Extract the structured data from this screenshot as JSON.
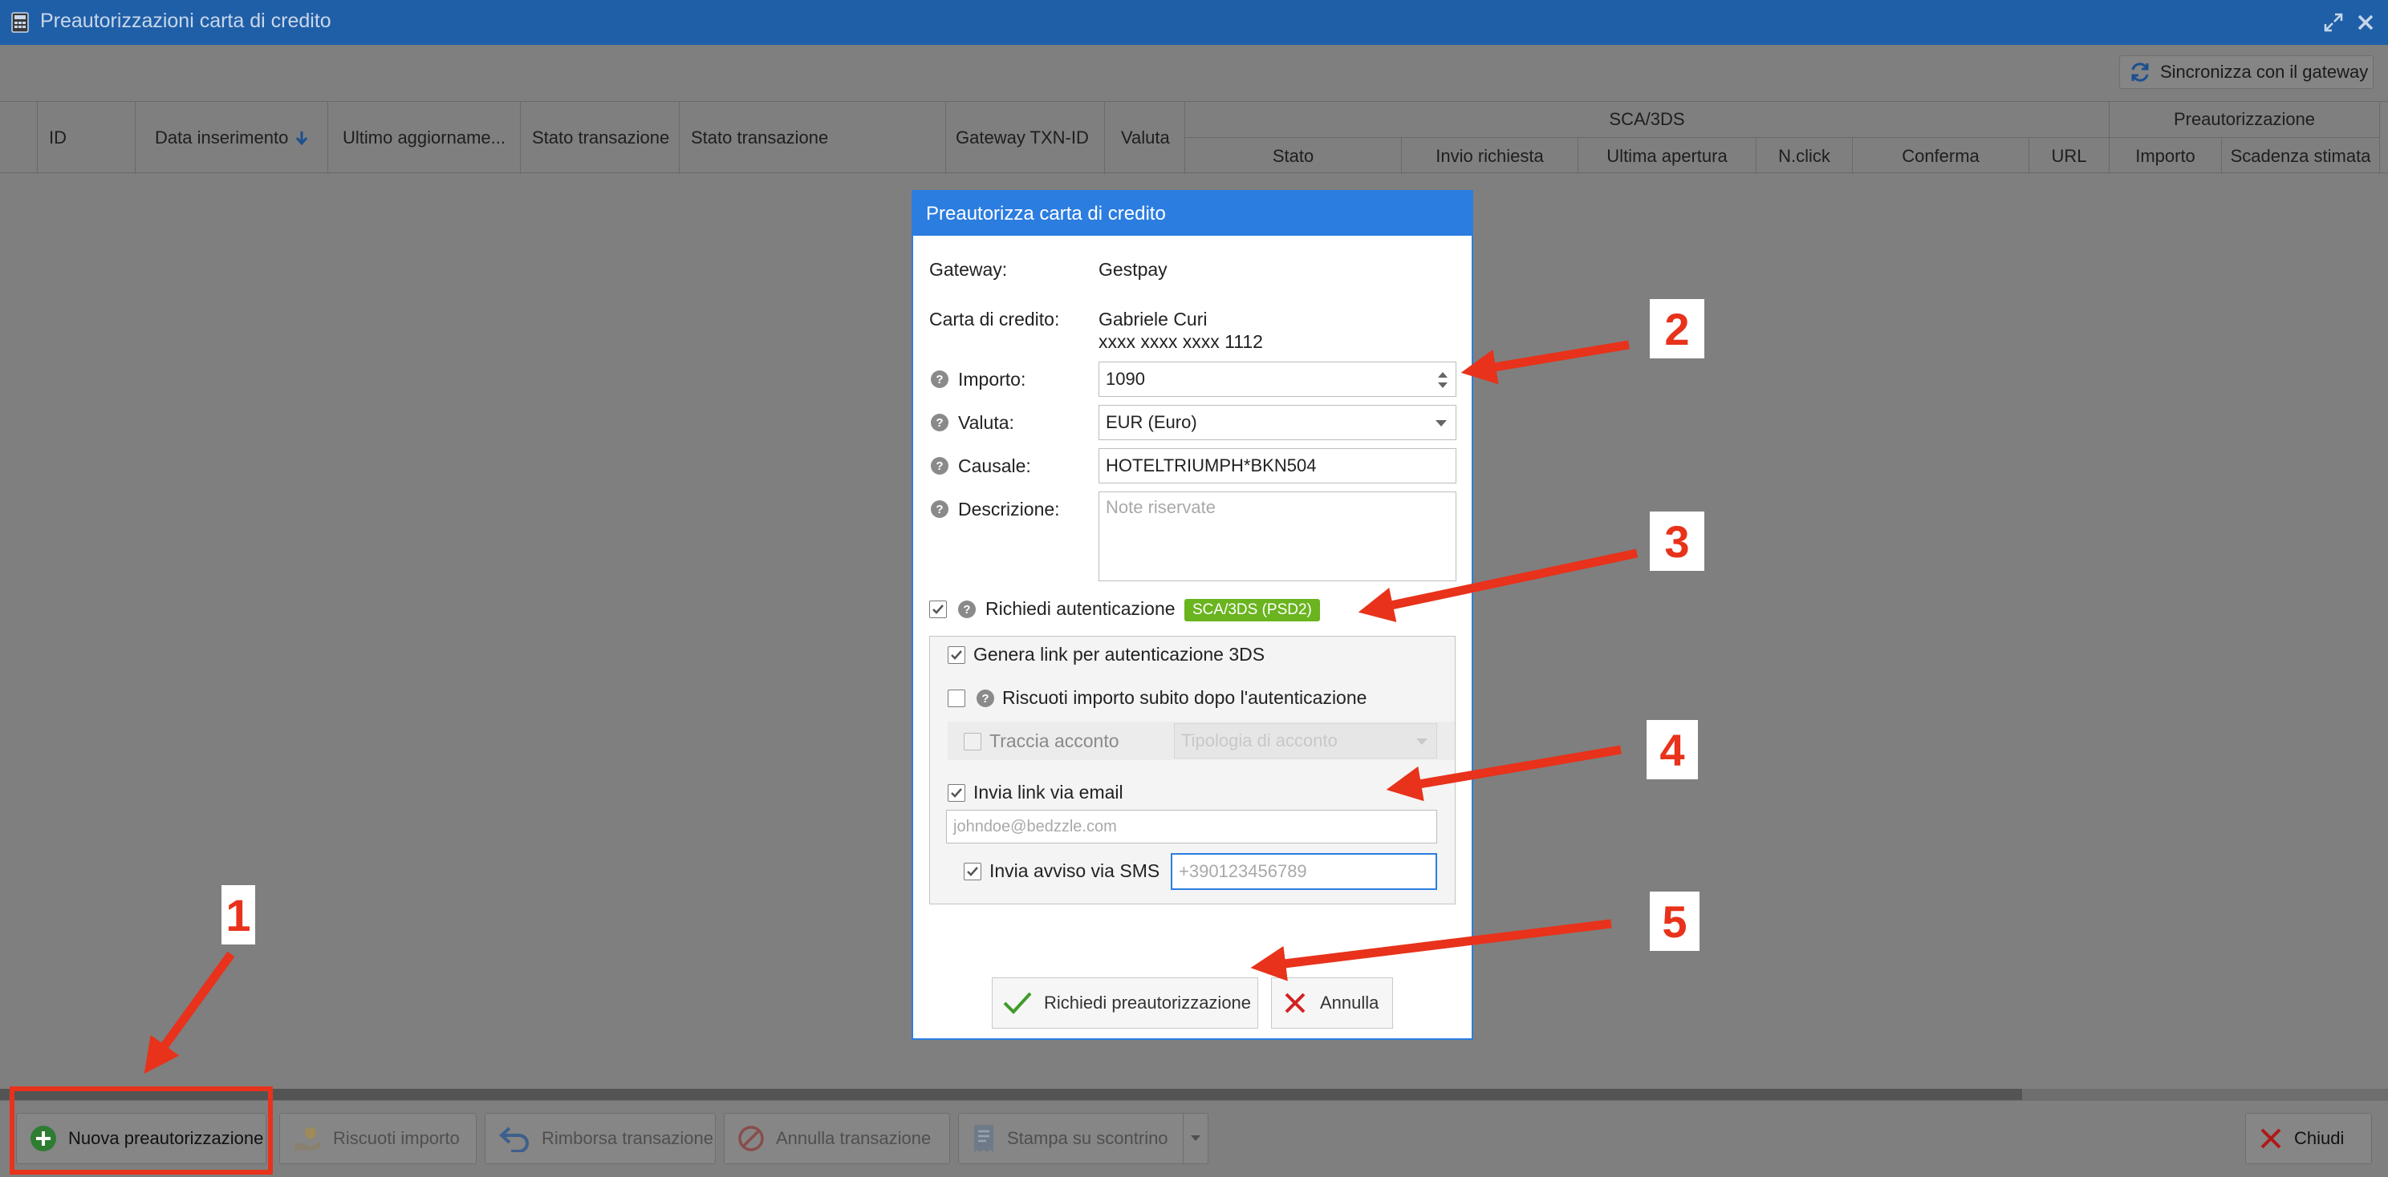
{
  "window": {
    "title": "Preautorizzazioni carta di credito",
    "sync_button": "Sincronizza con il gateway"
  },
  "grid": {
    "columns": [
      "ID",
      "Data inserimento",
      "Ultimo aggiorname...",
      "Stato transazione",
      "Stato transazione",
      "Gateway TXN-ID",
      "Valuta"
    ],
    "groups": [
      "SCA/3DS",
      "Preautorizzazione"
    ],
    "sca_subcolumns": [
      "Stato",
      "Invio richiesta",
      "Ultima apertura",
      "N.click",
      "Conferma",
      "URL"
    ],
    "preauth_subcolumns": [
      "Importo",
      "Scadenza stimata"
    ]
  },
  "bottom_toolbar": {
    "new": "Nuova preautorizzazione",
    "collect": "Riscuoti importo",
    "refund": "Rimborsa transazione",
    "cancel": "Annulla transazione",
    "print": "Stampa su scontrino",
    "close": "Chiudi"
  },
  "dialog": {
    "title": "Preautorizza carta di credito",
    "gateway_label": "Gateway:",
    "gateway_value": "Gestpay",
    "card_label": "Carta di credito:",
    "card_holder": "Gabriele Curi",
    "card_number": "xxxx xxxx xxxx 1112",
    "amount_label": "Importo:",
    "amount_value": "1090",
    "currency_label": "Valuta:",
    "currency_value": "EUR (Euro)",
    "reason_label": "Causale:",
    "reason_value": "HOTELTRIUMPH*BKN504",
    "description_label": "Descrizione:",
    "description_placeholder": "Note riservate",
    "auth_label": "Richiedi autenticazione",
    "auth_badge": "SCA/3DS (PSD2)",
    "gen_link_label": "Genera link per autenticazione 3DS",
    "collect_after_label": "Riscuoti importo subito dopo l'autenticazione",
    "track_deposit_label": "Traccia acconto",
    "deposit_type_placeholder": "Tipologia di acconto",
    "email_label": "Invia link via email",
    "email_placeholder": "johndoe@bedzzle.com",
    "sms_label": "Invia avviso via SMS",
    "sms_placeholder": "+390123456789",
    "submit_button": "Richiedi preautorizzazione",
    "cancel_button": "Annulla"
  },
  "annotations": [
    "1",
    "2",
    "3",
    "4",
    "5"
  ],
  "colors": {
    "titlebar": "#1f5fa8",
    "dialog_accent": "#2b7de0",
    "badge": "#6ab41f",
    "annotation": "#e8321b"
  }
}
